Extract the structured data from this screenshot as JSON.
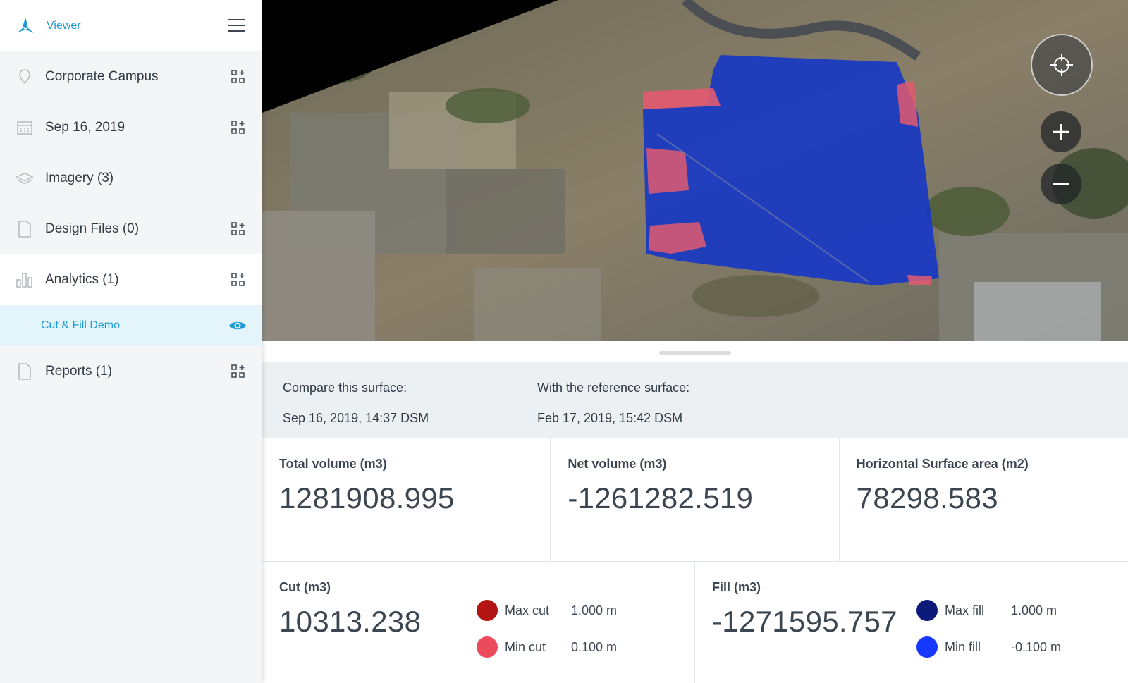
{
  "app": {
    "title": "Viewer"
  },
  "sidebar": {
    "items": [
      {
        "label": "Corporate Campus",
        "icon": "location-pin-icon"
      },
      {
        "label": "Sep 16, 2019",
        "icon": "calendar-icon"
      },
      {
        "label": "Imagery (3)",
        "icon": "layers-icon"
      },
      {
        "label": "Design Files (0)",
        "icon": "file-icon"
      },
      {
        "label": "Analytics (1)",
        "icon": "bar-chart-icon"
      },
      {
        "label": "Reports (1)",
        "icon": "file-icon"
      }
    ],
    "sub_item": {
      "label": "Cut & Fill Demo"
    }
  },
  "compare": {
    "this_label": "Compare this surface:",
    "this_value": "Sep 16, 2019, 14:37 DSM",
    "ref_label": "With the reference surface:",
    "ref_value": "Feb 17, 2019, 15:42 DSM"
  },
  "stats": {
    "total": {
      "label": "Total volume (m3)",
      "value": "1281908.995"
    },
    "net": {
      "label": "Net volume (m3)",
      "value": "-1261282.519"
    },
    "area": {
      "label": "Horizontal Surface area (m2)",
      "value": "78298.583"
    },
    "cut": {
      "label": "Cut (m3)",
      "value": "10313.238",
      "max_label": "Max cut",
      "max_value": "1.000  m",
      "min_label": "Min cut",
      "min_value": "0.100  m"
    },
    "fill": {
      "label": "Fill (m3)",
      "value": "-1271595.757",
      "max_label": "Max fill",
      "max_value": "1.000  m",
      "min_label": "Min fill",
      "min_value": "-0.100  m"
    }
  },
  "colors": {
    "accent": "#1d9ad6",
    "max_cut": "#b31414",
    "min_cut": "#ec4b5c",
    "max_fill": "#0c1a7a",
    "min_fill": "#1537ff"
  }
}
